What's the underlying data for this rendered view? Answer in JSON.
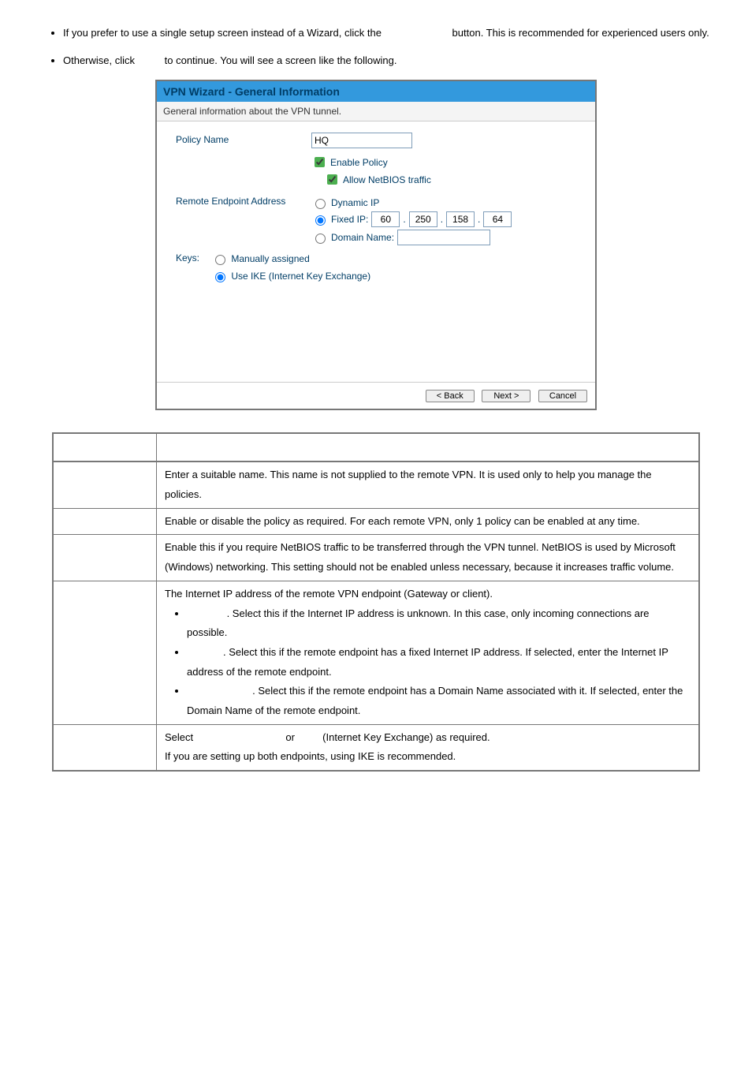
{
  "intro": {
    "bullet1_a": "If you prefer to use a single setup screen instead of a Wizard, click the ",
    "bullet1_b": " button. This is recommended for experienced users only.",
    "bullet2_a": "Otherwise, click ",
    "bullet2_b": " to continue. You will see a screen like the following."
  },
  "wizard": {
    "title": "VPN Wizard - General Information",
    "subtitle": "General information about the VPN tunnel.",
    "policy_name_label": "Policy Name",
    "policy_name_value": "HQ",
    "enable_policy_label": "Enable Policy",
    "allow_netbios_label": "Allow NetBIOS traffic",
    "remote_endpoint_label": "Remote Endpoint Address",
    "dynamic_ip_label": "Dynamic IP",
    "fixed_ip_label": "Fixed IP:",
    "fixed_ip": {
      "a": "60",
      "b": "250",
      "c": "158",
      "d": "64"
    },
    "domain_name_label": "Domain Name:",
    "keys_label": "Keys:",
    "keys_manual": "Manually assigned",
    "keys_ike": "Use IKE (Internet Key Exchange)",
    "back_btn": "< Back",
    "next_btn": "Next >",
    "cancel_btn": "Cancel"
  },
  "table": {
    "r1": "Enter a suitable name. This name is not supplied to the remote VPN. It is used only to help you manage the policies.",
    "r2": "Enable or disable the policy as required. For each remote VPN, only 1 policy can be enabled at any time.",
    "r3": "Enable this if you require NetBIOS traffic to be transferred through the VPN tunnel. NetBIOS is used by Microsoft (Windows) networking. This setting should not be enabled unless necessary, because it increases traffic volume.",
    "r4_intro": "The Internet IP address of the remote VPN endpoint (Gateway or client).",
    "r4_b1": ". Select this if the Internet IP address is unknown. In this case, only incoming connections are possible.",
    "r4_b2": ". Select this if the remote endpoint has a fixed Internet IP address. If selected, enter the Internet IP address of the remote endpoint.",
    "r4_b3": ". Select this if the remote endpoint has a Domain Name associated with it. If selected, enter the Domain Name of the remote endpoint.",
    "r5_a": "Select ",
    "r5_b": " or ",
    "r5_c": " (Internet Key Exchange) as required.",
    "r5_d": "If you are setting up both endpoints, using IKE is recommended."
  }
}
